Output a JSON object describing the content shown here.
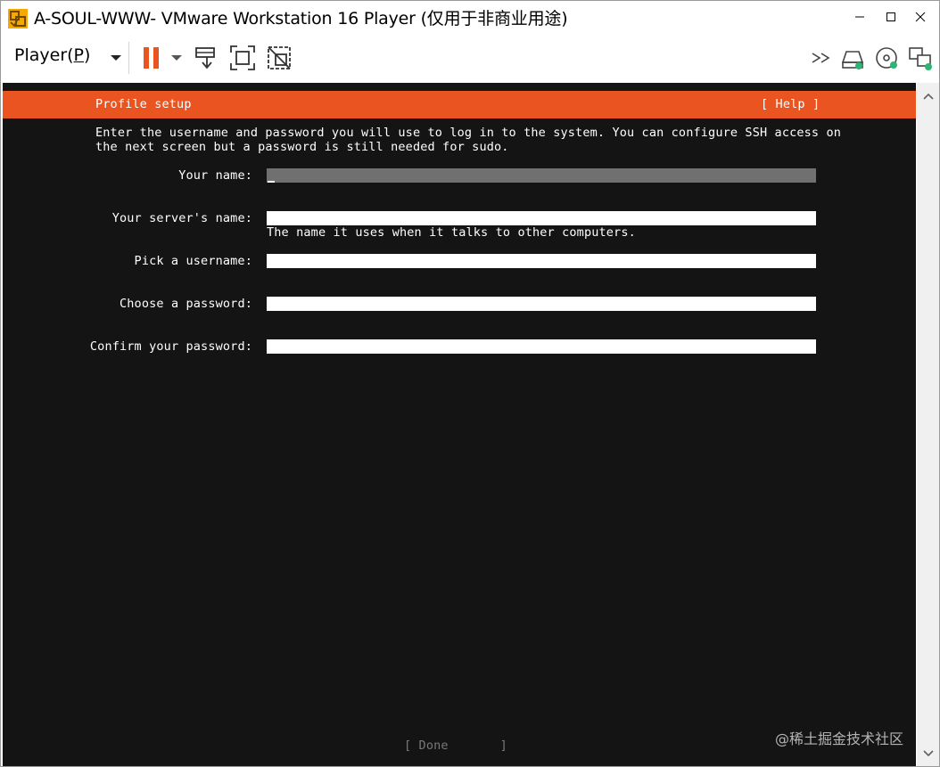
{
  "window": {
    "title": "A-SOUL-WWW- VMware Workstation 16 Player (仅用于非商业用途)",
    "controls": {
      "minimize_icon": "minimize-icon",
      "maximize_icon": "maximize-icon",
      "close_icon": "close-icon"
    }
  },
  "toolbar": {
    "player_menu_prefix": "Player(",
    "player_menu_key": "P",
    "player_menu_suffix": ")",
    "icons": [
      "pause-icon",
      "send-ctrl-alt-del-icon",
      "fullscreen-icon",
      "unity-icon",
      "more-devices-icon",
      "hard-disk-icon",
      "cd-dvd-icon",
      "network-adapter-icon"
    ],
    "accent_color": "#e95420",
    "device_active_color": "#2bb673"
  },
  "console": {
    "header": {
      "title": "Profile setup",
      "help": "[ Help ]",
      "bar_color": "#e95420"
    },
    "intro_line1": "Enter the username and password you will use to log in to the system. You can configure SSH access on",
    "intro_line2": "the next screen but a password is still needed for sudo.",
    "fields": [
      {
        "label": "Your name:",
        "value": "",
        "focused": true
      },
      {
        "label": "Your server's name:",
        "value": "",
        "hint": "The name it uses when it talks to other computers."
      },
      {
        "label": "Pick a username:",
        "value": ""
      },
      {
        "label": "Choose a password:",
        "value": ""
      },
      {
        "label": "Confirm your password:",
        "value": ""
      }
    ],
    "done_button": "[ Done       ]",
    "background_color": "#141414"
  },
  "watermark": "@稀土掘金技术社区"
}
